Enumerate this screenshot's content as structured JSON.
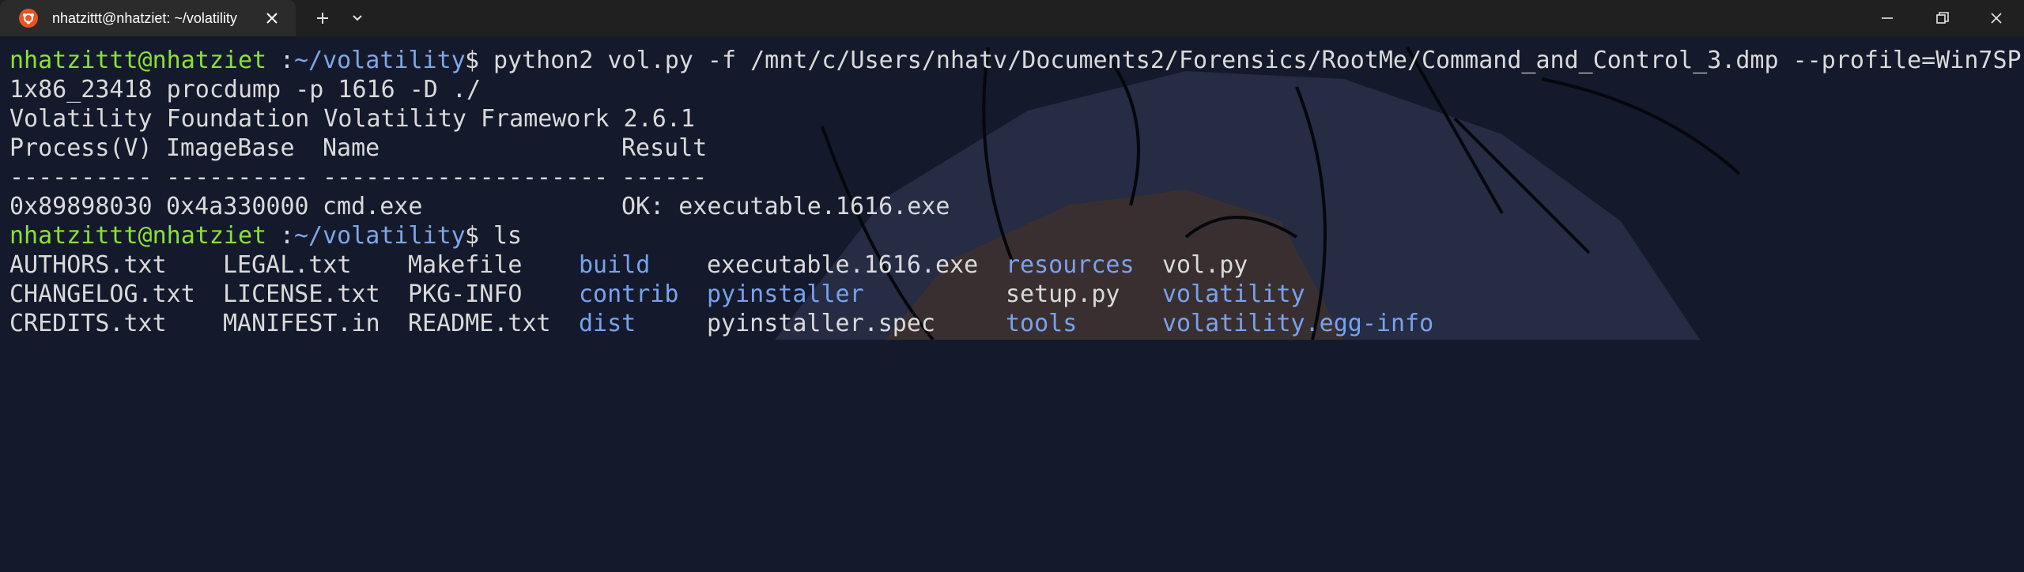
{
  "window": {
    "tab_title": "nhatzittt@nhatziet: ~/volatility",
    "icons": {
      "app": "ubuntu-icon",
      "close_tab": "close-icon",
      "new_tab": "plus-icon",
      "dropdown": "chevron-down-icon",
      "minimize": "minimize-icon",
      "maximize": "restore-icon",
      "close_window": "close-icon"
    }
  },
  "colors": {
    "prompt_user": "#8ae234",
    "prompt_path": "#7fa6e8",
    "directory": "#78a2ef",
    "text": "#dadada",
    "ubuntu_orange": "#e95420"
  },
  "terminal": {
    "cmd1": {
      "user": "nhatzittt@nhatziet",
      "sep": ":",
      "path": "~/volatility",
      "dollar": "$ ",
      "command": "python2 vol.py -f /mnt/c/Users/nhatv/Documents2/Forensics/RootMe/Command_and_Control_3.dmp --profile=Win7SP",
      "command_wrap": "1x86_23418 procdump -p 1616 -D ./"
    },
    "banner": "Volatility Foundation Volatility Framework 2.6.1",
    "table": {
      "headers": [
        "Process(V)",
        "ImageBase",
        "Name",
        "Result"
      ],
      "separators": [
        "----------",
        "----------",
        "--------------------",
        "------"
      ],
      "row": [
        "0x89898030",
        "0x4a330000",
        "cmd.exe",
        "OK: executable.1616.exe"
      ]
    },
    "cmd2": {
      "user": "nhatzittt@nhatziet",
      "sep": ":",
      "path": "~/volatility",
      "dollar": "$ ",
      "command": "ls"
    },
    "ls": {
      "row1": [
        "AUTHORS.txt",
        "LEGAL.txt",
        "Makefile",
        "build",
        "executable.1616.exe",
        "resources",
        "vol.py"
      ],
      "row2": [
        "CHANGELOG.txt",
        "LICENSE.txt",
        "PKG-INFO",
        "contrib",
        "pyinstaller",
        "setup.py",
        "volatility"
      ],
      "row3": [
        "CREDITS.txt",
        "MANIFEST.in",
        "README.txt",
        "dist",
        "pyinstaller.spec",
        "tools",
        "volatility.egg-info"
      ]
    }
  }
}
